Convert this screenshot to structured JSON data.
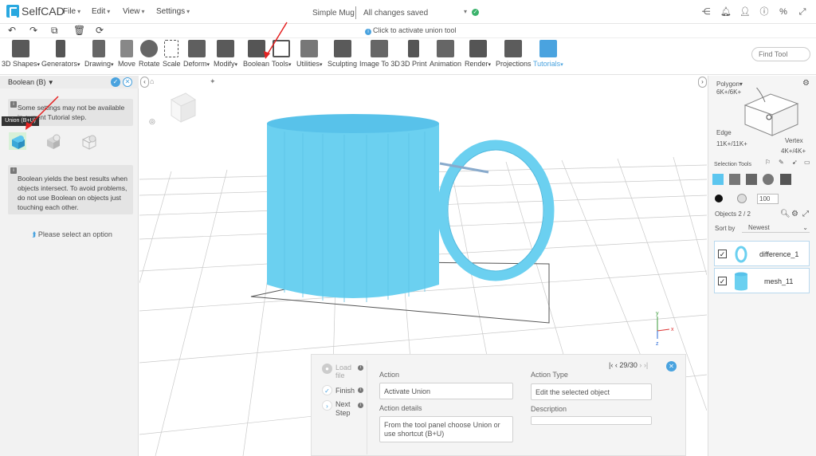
{
  "app": {
    "name": "SelfCAD",
    "doc_title": "Simple Mug",
    "save_status": "All changes saved"
  },
  "menus": [
    "File",
    "Edit",
    "View",
    "Settings"
  ],
  "hint": "Click to activate union tool",
  "toolbar": {
    "tools": [
      {
        "label": "3D Shapes",
        "dropdown": true
      },
      {
        "label": "Generators",
        "dropdown": true
      },
      {
        "label": "Drawing",
        "dropdown": true
      },
      {
        "label": "Move",
        "dropdown": false
      },
      {
        "label": "Rotate",
        "dropdown": false
      },
      {
        "label": "Scale",
        "dropdown": false
      },
      {
        "label": "Deform",
        "dropdown": true
      },
      {
        "label": "Modify",
        "dropdown": true
      },
      {
        "label": "Boolean",
        "dropdown": false
      },
      {
        "label": "Tools",
        "dropdown": true
      },
      {
        "label": "Utilities",
        "dropdown": true
      },
      {
        "label": "Sculpting",
        "dropdown": false
      },
      {
        "label": "Image To 3D",
        "dropdown": false
      },
      {
        "label": "3D Print",
        "dropdown": false
      },
      {
        "label": "Animation",
        "dropdown": false
      },
      {
        "label": "Render",
        "dropdown": true
      },
      {
        "label": "Projections",
        "dropdown": false
      },
      {
        "label": "Tutorials",
        "dropdown": true
      }
    ],
    "find_tool": "Find Tool"
  },
  "left_panel": {
    "title": "Boolean (B)",
    "note1": "Some settings may not be available in current Tutorial step.",
    "tooltip": "Union (B+U)",
    "note2": "Boolean yields the best results when objects intersect. To avoid problems, do not use Boolean on objects just touching each other.",
    "select_option": "Please select an option"
  },
  "tutorial": {
    "steps": [
      {
        "label": "Load file",
        "state": "pending"
      },
      {
        "label": "Finish",
        "state": "done"
      },
      {
        "label": "Next Step",
        "state": "next"
      }
    ],
    "action_label": "Action",
    "action_value": "Activate Union",
    "details_label": "Action details",
    "details_value": "From the tool panel choose Union or use shortcut (B+U)",
    "type_label": "Action Type",
    "type_value": "Edit the selected object",
    "description_label": "Description",
    "description_value": "",
    "pager": "29/30"
  },
  "right_panel": {
    "polygon_label": "Polygon",
    "polygon_count": "6K+/6K+",
    "edge_label": "Edge",
    "edge_count": "11K+/11K+",
    "vertex_label": "Vertex",
    "vertex_count": "4K+/4K+",
    "selection_tools": "Selection Tools",
    "brush_size": "100",
    "objects_label": "Objects 2 / 2",
    "sort_label": "Sort by",
    "sort_value": "Newest",
    "objects": [
      {
        "name": "difference_1",
        "checked": true,
        "kind": "ring"
      },
      {
        "name": "mesh_11",
        "checked": true,
        "kind": "cylinder"
      }
    ]
  },
  "colors": {
    "accent": "#4aa3df",
    "mesh": "#6bd0f0",
    "saved": "#3bb36c",
    "annotation": "#e52222"
  }
}
